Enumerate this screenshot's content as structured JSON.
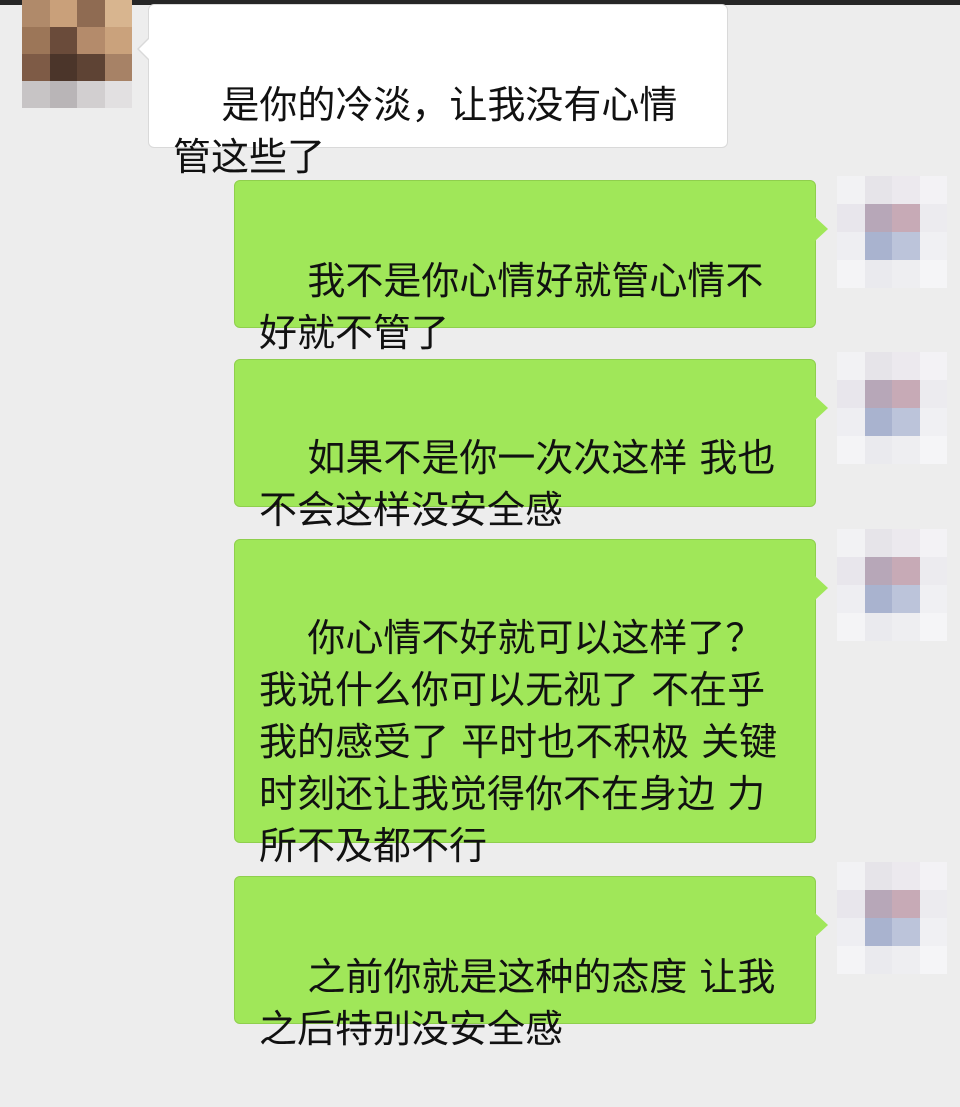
{
  "chat": {
    "messages": [
      {
        "side": "in",
        "text": "是你的冷淡，让我没有心情管这些了"
      },
      {
        "side": "out",
        "text": "我不是你心情好就管心情不好就不管了"
      },
      {
        "side": "out",
        "text": "如果不是你一次次这样 我也不会这样没安全感"
      },
      {
        "side": "out",
        "text": "你心情不好就可以这样了？我说什么你可以无视了 不在乎我的感受了 平时也不积极 关键时刻还让我觉得你不在身边 力所不及都不行"
      },
      {
        "side": "out",
        "text": "之前你就是这种的态度 让我之后特别没安全感"
      }
    ]
  },
  "colors": {
    "background": "#ededed",
    "outgoing_bubble": "#a0e759",
    "incoming_bubble": "#ffffff",
    "top_bar": "#262626"
  }
}
